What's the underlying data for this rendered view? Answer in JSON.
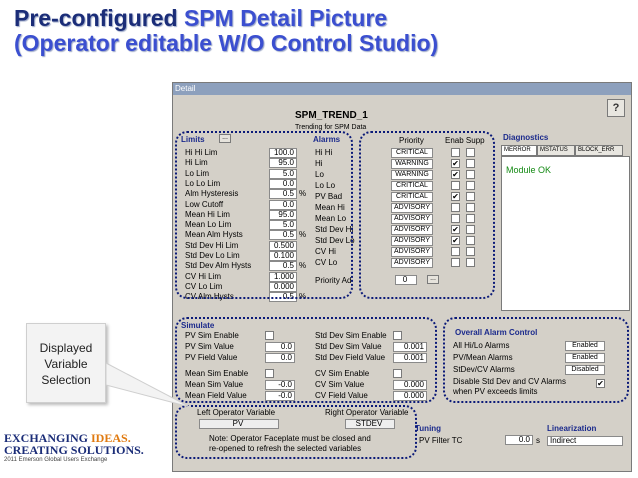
{
  "slide": {
    "title_part1": "Pre-configured ",
    "title_part2": "SPM Detail Picture",
    "title_line2": "(Operator editable W/O Control Studio)",
    "callout": "Displayed Variable Selection",
    "logo_line1a": "EXCHANGING ",
    "logo_line1b": "IDEAS.",
    "logo_line1c": "CREATING SOLUTIONS.",
    "logo_line2": "2011 Emerson Global Users Exchange"
  },
  "window": {
    "title": "Detail",
    "header": "SPM_TREND_1",
    "subheader": "Trending for SPM Data",
    "help_label": "?"
  },
  "limits": {
    "title": "Limits",
    "browse": "...",
    "rows": [
      {
        "label": "Hi Hi Lim",
        "value": "100.0",
        "unit": ""
      },
      {
        "label": "Hi Lim",
        "value": "95.0",
        "unit": ""
      },
      {
        "label": "Lo Lim",
        "value": "5.0",
        "unit": ""
      },
      {
        "label": "Lo Lo Lim",
        "value": "0.0",
        "unit": ""
      },
      {
        "label": "Alm Hysteresis",
        "value": "0.5",
        "unit": "%"
      },
      {
        "label": "Low Cutoff",
        "value": "0.0",
        "unit": ""
      },
      {
        "label": "Mean Hi Lim",
        "value": "95.0",
        "unit": ""
      },
      {
        "label": "Mean Lo Lim",
        "value": "5.0",
        "unit": ""
      },
      {
        "label": "Mean Alm Hysts",
        "value": "0.5",
        "unit": "%"
      },
      {
        "label": "Std Dev Hi Lim",
        "value": "0.500",
        "unit": ""
      },
      {
        "label": "Std Dev Lo Lim",
        "value": "0.100",
        "unit": ""
      },
      {
        "label": "Std Dev Alm Hysts",
        "value": "0.5",
        "unit": "%"
      },
      {
        "label": "CV Hi Lim",
        "value": "1.000",
        "unit": ""
      },
      {
        "label": "CV Lo Lim",
        "value": "0.000",
        "unit": ""
      },
      {
        "label": "CV Alm Hysts",
        "value": "0.5",
        "unit": "%"
      }
    ]
  },
  "alarms": {
    "title": "Alarms",
    "col_priority": "Priority",
    "col_enab_supp": "Enab Supp",
    "rows": [
      {
        "label": "Hi Hi",
        "priority": "CRITICAL",
        "enab": "",
        "supp": ""
      },
      {
        "label": "Hi",
        "priority": "WARNING",
        "enab": "✔",
        "supp": ""
      },
      {
        "label": "Lo",
        "priority": "WARNING",
        "enab": "✔",
        "supp": ""
      },
      {
        "label": "Lo Lo",
        "priority": "CRITICAL",
        "enab": "",
        "supp": ""
      },
      {
        "label": "PV Bad",
        "priority": "CRITICAL",
        "enab": "✔",
        "supp": ""
      },
      {
        "label": "Mean Hi",
        "priority": "ADVISORY",
        "enab": "",
        "supp": ""
      },
      {
        "label": "Mean Lo",
        "priority": "ADVISORY",
        "enab": "",
        "supp": ""
      },
      {
        "label": "Std Dev Hi",
        "priority": "ADVISORY",
        "enab": "✔",
        "supp": ""
      },
      {
        "label": "Std Dev Lo",
        "priority": "ADVISORY",
        "enab": "✔",
        "supp": ""
      },
      {
        "label": "CV Hi",
        "priority": "ADVISORY",
        "enab": "",
        "supp": ""
      },
      {
        "label": "CV Lo",
        "priority": "ADVISORY",
        "enab": "",
        "supp": ""
      }
    ],
    "priority_adj_label": "Priority Ad",
    "priority_adj_value": "0",
    "priority_adj_browse": "..."
  },
  "diagnostics": {
    "title": "Diagnostics",
    "tabs": [
      "MERROR",
      "MSTATUS",
      "BLOCK_ERR"
    ],
    "status": "Module OK"
  },
  "simulate": {
    "title": "Simulate",
    "left": [
      {
        "label": "PV Sim Enable",
        "kind": "check",
        "value": ""
      },
      {
        "label": "PV Sim Value",
        "kind": "field",
        "value": "0.0"
      },
      {
        "label": "PV Field Value",
        "kind": "field",
        "value": "0.0"
      },
      {
        "label": "Mean Sim Enable",
        "kind": "check",
        "value": ""
      },
      {
        "label": "Mean Sim Value",
        "kind": "field",
        "value": "-0.0"
      },
      {
        "label": "Mean Field Value",
        "kind": "field",
        "value": "-0.0"
      }
    ],
    "right": [
      {
        "label": "Std Dev Sim Enable",
        "kind": "check",
        "value": ""
      },
      {
        "label": "Std Dev Sim Value",
        "kind": "field",
        "value": "0.001"
      },
      {
        "label": "Std Dev Field Value",
        "kind": "field",
        "value": "0.001"
      },
      {
        "label": "CV Sim Enable",
        "kind": "check",
        "value": ""
      },
      {
        "label": "CV Sim Value",
        "kind": "field",
        "value": "0.000"
      },
      {
        "label": "CV Field Value",
        "kind": "field",
        "value": "0.000"
      }
    ]
  },
  "overall_alarm": {
    "title": "Overall Alarm Control",
    "rows": [
      {
        "label": "All Hi/Lo Alarms",
        "value": "Enabled"
      },
      {
        "label": "PV/Mean Alarms",
        "value": "Enabled"
      },
      {
        "label": "StDev/CV Alarms",
        "value": "Disabled"
      }
    ],
    "disable_label_line1": "Disable Std Dev and CV Alarms",
    "disable_label_line2": "when   PV   exceeds limits",
    "disable_checked": "✔"
  },
  "operator_vars": {
    "left_label": "Left Operator Variable",
    "left_value": "PV",
    "right_label": "Right Operator Variable",
    "right_value": "STDEV",
    "note_line1": "Note: Operator Faceplate must be closed and",
    "note_line2": "re-opened to refresh the selected variables"
  },
  "tuning": {
    "title": "Tuning",
    "filter_label": "PV Filter TC",
    "filter_value": "0.0",
    "filter_unit": "s"
  },
  "linearization": {
    "title": "Linearization",
    "value": "Indirect"
  }
}
